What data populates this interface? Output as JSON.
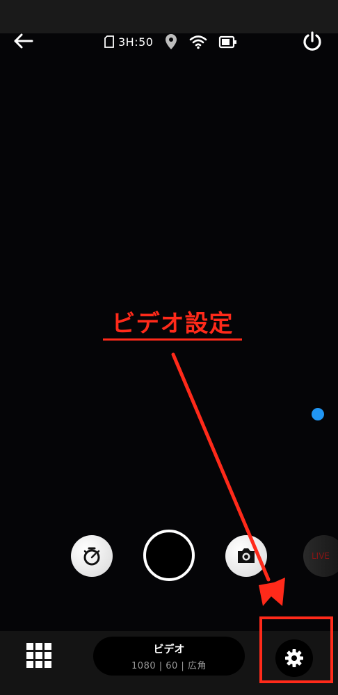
{
  "status": {
    "sd_remaining": "3H:50"
  },
  "annotation": {
    "label": "ビデオ設定",
    "color": "#ff2a1a"
  },
  "controls": {
    "live_label": "LIVE"
  },
  "mode": {
    "title": "ビデオ",
    "subtitle": "1080 | 60 | 広角"
  },
  "icons": [
    "back-arrow-icon",
    "sd-card-icon",
    "location-pin-icon",
    "wifi-icon",
    "battery-icon",
    "power-icon",
    "timer-icon",
    "camera-icon",
    "grid-icon",
    "gear-icon"
  ],
  "colors": {
    "background": "#000000",
    "bar": "#141414",
    "accent_dot": "#2196f3",
    "live_text": "#8a1414"
  }
}
